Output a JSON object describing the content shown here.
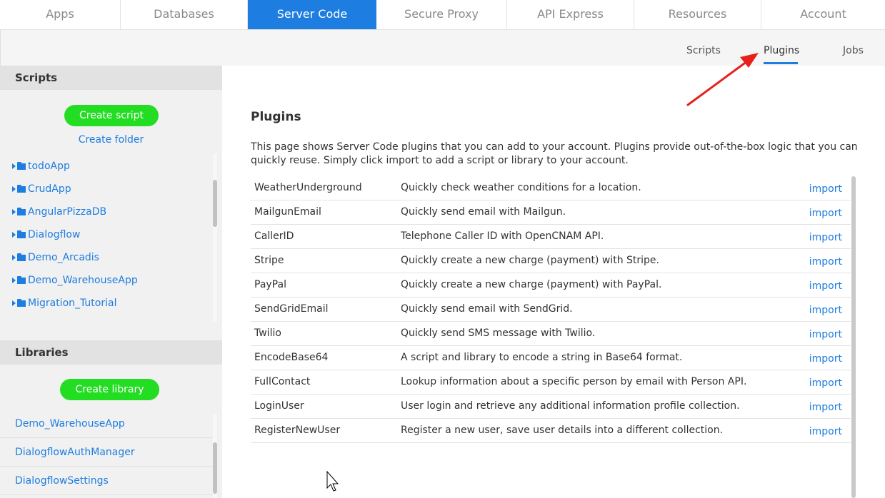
{
  "topnav": {
    "tabs": [
      {
        "label": "Apps"
      },
      {
        "label": "Databases"
      },
      {
        "label": "Server Code"
      },
      {
        "label": "Secure Proxy"
      },
      {
        "label": "API Express"
      },
      {
        "label": "Resources"
      },
      {
        "label": "Account"
      }
    ],
    "active_tab": "Server Code"
  },
  "subnav": {
    "items": [
      {
        "label": "Scripts"
      },
      {
        "label": "Plugins"
      },
      {
        "label": "Jobs"
      }
    ],
    "active_item": "Plugins"
  },
  "sidebar": {
    "scripts_title": "Scripts",
    "create_script_label": "Create script",
    "create_folder_label": "Create folder",
    "folders": [
      {
        "label": "todoApp"
      },
      {
        "label": "CrudApp"
      },
      {
        "label": "AngularPizzaDB"
      },
      {
        "label": "Dialogflow"
      },
      {
        "label": "Demo_Arcadis"
      },
      {
        "label": "Demo_WarehouseApp"
      },
      {
        "label": "Migration_Tutorial"
      }
    ],
    "libraries_title": "Libraries",
    "create_library_label": "Create library",
    "libraries": [
      {
        "label": "Demo_WarehouseApp"
      },
      {
        "label": "DialogflowAuthManager"
      },
      {
        "label": "DialogflowSettings"
      }
    ]
  },
  "main": {
    "title": "Plugins",
    "description": "This page shows Server Code plugins that you can add to your account. Plugins provide out-of-the-box logic that you can quickly reuse. Simply click import to add a script or library to your account.",
    "import_label": "import",
    "plugins": [
      {
        "name": "WeatherUnderground",
        "description": "Quickly check weather conditions for a location."
      },
      {
        "name": "MailgunEmail",
        "description": "Quickly send email with Mailgun."
      },
      {
        "name": "CallerID",
        "description": "Telephone Caller ID with OpenCNAM API."
      },
      {
        "name": "Stripe",
        "description": "Quickly create a new charge (payment) with Stripe."
      },
      {
        "name": "PayPal",
        "description": "Quickly create a new charge (payment) with PayPal."
      },
      {
        "name": "SendGridEmail",
        "description": "Quickly send email with SendGrid."
      },
      {
        "name": "Twilio",
        "description": "Quickly send SMS message with Twilio."
      },
      {
        "name": "EncodeBase64",
        "description": "A script and library to encode a string in Base64 format."
      },
      {
        "name": "FullContact",
        "description": "Lookup information about a specific person by email with Person API."
      },
      {
        "name": "LoginUser",
        "description": "User login and retrieve any additional information profile collection."
      },
      {
        "name": "RegisterNewUser",
        "description": "Register a new user, save user details into a different collection."
      }
    ]
  },
  "colors": {
    "accent": "#1e7de0",
    "green_button": "#22dd22",
    "annotation_arrow": "#e8201a"
  },
  "icons": {
    "folder": "folder-icon",
    "caret": "caret-right-icon",
    "cursor": "mouse-pointer-icon",
    "annotation": "red-arrow-icon"
  }
}
